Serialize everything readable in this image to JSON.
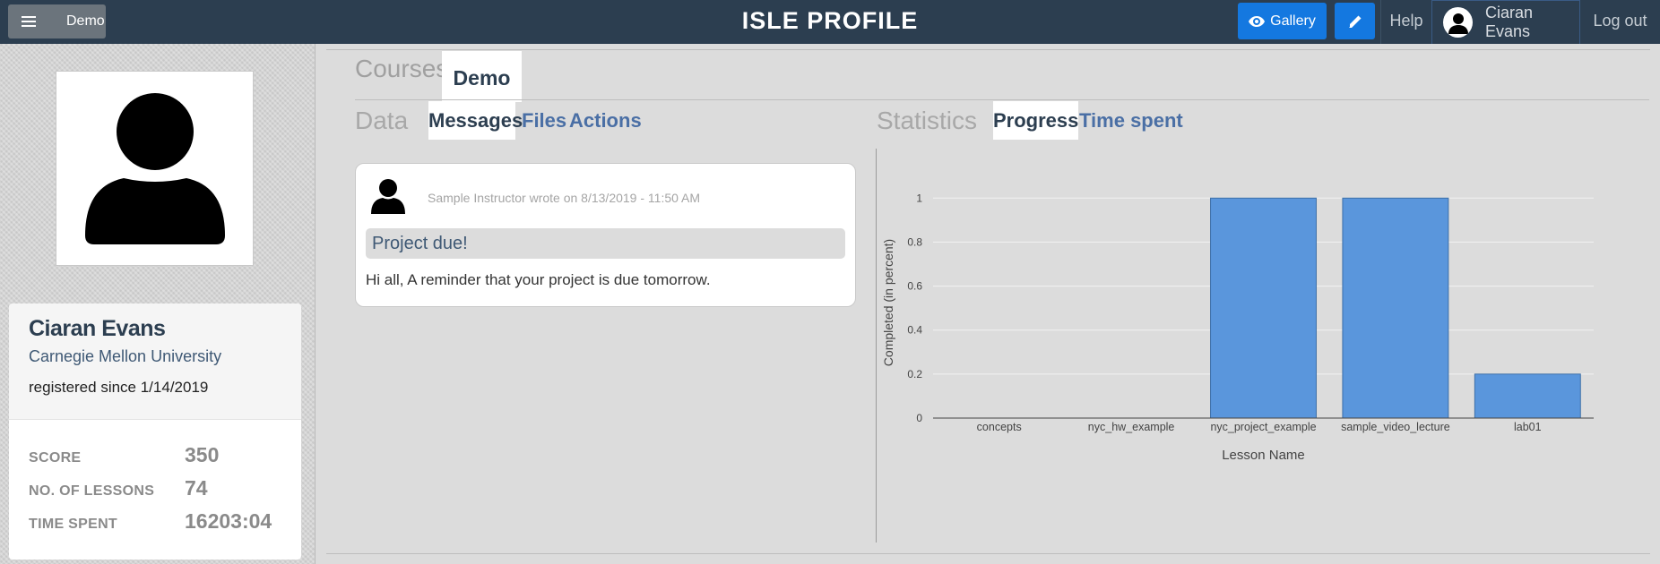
{
  "topbar": {
    "course_button_label": "Demo",
    "brand": "ISLE PROFILE",
    "gallery_label": "Gallery",
    "help_label": "Help",
    "user_name": "Ciaran Evans",
    "logout_label": "Log out"
  },
  "profile": {
    "name": "Ciaran Evans",
    "organization": "Carnegie Mellon University",
    "registered": "registered since 1/14/2019",
    "stats": [
      {
        "label": "SCORE",
        "value": "350"
      },
      {
        "label": "NO. OF LESSONS",
        "value": "74"
      },
      {
        "label": "TIME SPENT",
        "value": "16203:04"
      }
    ]
  },
  "courses": {
    "label": "Courses",
    "active_course": "Demo"
  },
  "data_section": {
    "label": "Data",
    "tabs": [
      "Messages",
      "Files",
      "Actions"
    ],
    "active_tab": "Messages"
  },
  "statistics_section": {
    "label": "Statistics",
    "tabs": [
      "Progress",
      "Time spent"
    ],
    "active_tab": "Progress"
  },
  "message": {
    "author_line": "Sample Instructor wrote on 8/13/2019 - 11:50 AM",
    "title": "Project due!",
    "body": "Hi all, A reminder that your project is due tomorrow."
  },
  "chart_data": {
    "type": "bar",
    "categories": [
      "concepts",
      "nyc_hw_example",
      "nyc_project_example",
      "sample_video_lecture",
      "lab01"
    ],
    "values": [
      0,
      0,
      1,
      1,
      0.2
    ],
    "xlabel": "Lesson Name",
    "ylabel": "Completed (in percent)",
    "ylim": [
      0,
      1.05
    ],
    "yticks": [
      0,
      0.2,
      0.4,
      0.6,
      0.8,
      1
    ],
    "grid": true,
    "bar_color": "#5a96dc"
  },
  "colors": {
    "topbar": "#2c3e50",
    "accent_button": "#1478e0",
    "link": "#4a6fa5"
  }
}
